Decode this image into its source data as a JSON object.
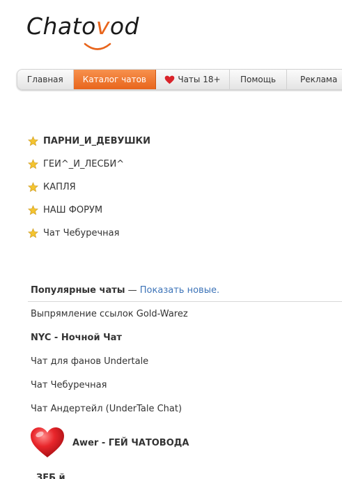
{
  "logo": {
    "text_before": "Chato",
    "text_accent": "v",
    "text_after": "od",
    "brand_color": "#e8651c"
  },
  "nav": {
    "items": [
      {
        "label": "Главная"
      },
      {
        "label": "Каталог чатов",
        "active": true
      },
      {
        "label": "Чаты 18+",
        "icon": "heart-icon"
      },
      {
        "label": "Помощь"
      },
      {
        "label": "Реклама"
      }
    ],
    "active_color": "#e8651c"
  },
  "favorites": {
    "icon": "star-icon",
    "items": [
      {
        "label": "ПАРНИ_И_ДЕВУШКИ",
        "bold": true
      },
      {
        "label": "ГЕИ^_И_ЛЕСБИ^"
      },
      {
        "label": "КАПЛЯ"
      },
      {
        "label": "НАШ ФОРУМ"
      },
      {
        "label": "Чат Чебуречная"
      }
    ]
  },
  "popular": {
    "title": "Популярные чаты",
    "separator": " — ",
    "show_new_link": "Показать новые.",
    "link_color": "#3d74b8",
    "items": [
      {
        "label": "Выпрямление ссылок Gold-Warez"
      },
      {
        "label": "NYC - Ночной Чат",
        "bold": true
      },
      {
        "label": "Чат для фанов Undertale"
      },
      {
        "label": "Чат Чебуречная"
      },
      {
        "label": "Чат Андертейл (UnderTale Chat)"
      }
    ],
    "featured": {
      "label": "Awer - ГЕЙ ЧАТОВОДА",
      "icon": "heart-icon"
    },
    "partial_next": "ЗЕБ й"
  }
}
